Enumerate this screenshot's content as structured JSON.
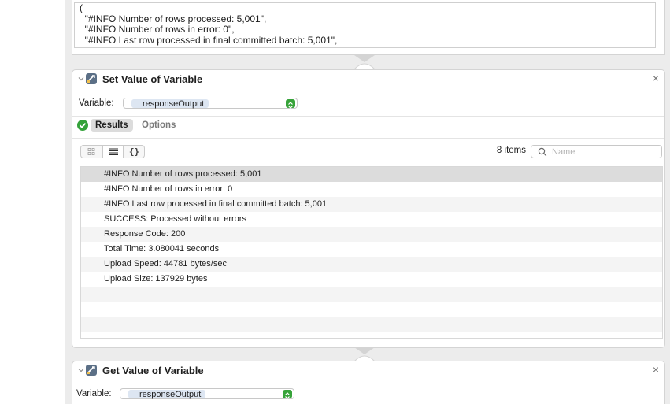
{
  "top_output": {
    "lines": [
      "(",
      "  \"#INFO Number of rows processed: 5,001\",",
      "  \"#INFO Number of rows in error: 0\",",
      "  \"#INFO Last row processed in final committed batch: 5,001\","
    ]
  },
  "set_action": {
    "title": "Set Value of Variable",
    "variable_label": "Variable:",
    "variable_value": "responseOutput",
    "tabs": {
      "results": "Results",
      "options": "Options"
    },
    "view_modes": [
      "icon-view",
      "list-view",
      "json-view"
    ],
    "json_glyph": "{}",
    "items_count": "8 items",
    "search_placeholder": "Name",
    "results": [
      "#INFO Number of rows processed: 5,001",
      "#INFO Number of rows in error: 0",
      "#INFO Last row processed in final committed batch: 5,001",
      "SUCCESS: Processed without errors",
      "Response Code: 200",
      "Total Time: 3.080041 seconds",
      "Upload Speed: 44781 bytes/sec",
      "Upload Size: 137929 bytes"
    ]
  },
  "get_action": {
    "title": "Get Value of Variable",
    "variable_label": "Variable:",
    "variable_value": "responseOutput"
  },
  "close_glyph": "×",
  "colors": {
    "canvas": "#ececec",
    "success_green": "#34a23a",
    "token_bg": "#dde6f2",
    "selected_row": "#dcdcdc"
  }
}
